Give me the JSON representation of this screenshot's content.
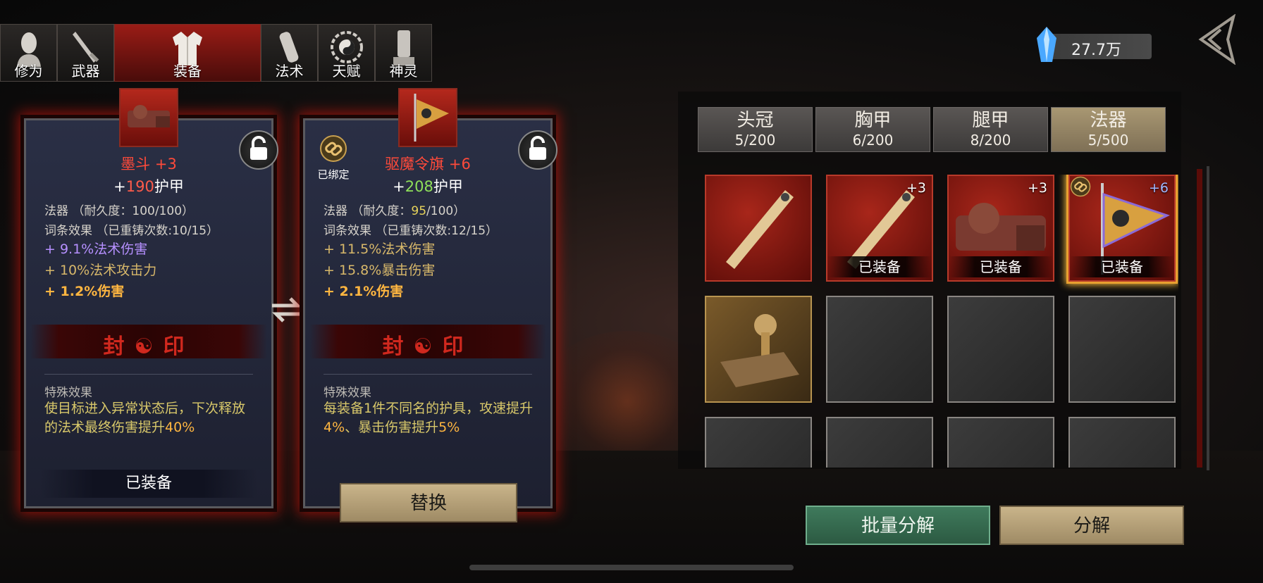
{
  "nav_tabs": [
    {
      "label": "修为",
      "icon": "cultivator-bust-icon",
      "active": false
    },
    {
      "label": "武器",
      "icon": "sword-icon",
      "active": false
    },
    {
      "label": "装备",
      "icon": "robe-icon",
      "active": true
    },
    {
      "label": "法术",
      "icon": "gourd-icon",
      "active": false
    },
    {
      "label": "天赋",
      "icon": "bagua-icon",
      "active": false
    },
    {
      "label": "神灵",
      "icon": "tablet-icon",
      "active": false
    }
  ],
  "currency": {
    "value": "27.7万",
    "icon": "spirit-crystal-icon"
  },
  "left_card": {
    "name": "墨斗 +3",
    "armor_prefix": "+",
    "armor_value": "190",
    "armor_suffix": "护甲",
    "type_label": "法器",
    "durability_label": "（耐久度：",
    "durability_current": "100",
    "durability_max": "/100）",
    "affix_label": "词条效果 （已重铸次数:10/15）",
    "affixes": [
      "+ 9.1%法术伤害",
      "+ 10%法术攻击力",
      "+ 1.2%伤害"
    ],
    "seal_text": "封☯印",
    "special_header": "特殊效果",
    "special_desc_a": "使目标进入异常状态后，下次释放的法术最终伤害提升",
    "special_desc_b": "40%",
    "status": "已装备"
  },
  "right_card": {
    "name": "驱魔令旗 +6",
    "bound_label": "已绑定",
    "armor_prefix": "+",
    "armor_value": "208",
    "armor_suffix": "护甲",
    "type_label": "法器",
    "durability_label": "（耐久度：",
    "durability_current": "95",
    "durability_max": "/100）",
    "affix_label": "词条效果 （已重铸次数:12/15）",
    "affixes": [
      "+ 11.5%法术伤害",
      "+ 15.8%暴击伤害",
      "+ 2.1%伤害"
    ],
    "seal_text": "封☯印",
    "special_header": "特殊效果",
    "special_desc_a": "每装备1件不同名的护具，攻速提升",
    "special_desc_b": "4%",
    "special_desc_c": "、暴击伤害提升",
    "special_desc_d": "5%"
  },
  "buttons": {
    "replace": "替换",
    "batch_decompose": "批量分解",
    "decompose": "分解"
  },
  "inventory_tabs": [
    {
      "label": "头冠",
      "count": "5/200",
      "active": false
    },
    {
      "label": "胸甲",
      "count": "6/200",
      "active": false
    },
    {
      "label": "腿甲",
      "count": "8/200",
      "active": false
    },
    {
      "label": "法器",
      "count": "5/500",
      "active": true
    }
  ],
  "inventory": [
    {
      "item": "ruler-talisman",
      "plus": "",
      "equipped": ""
    },
    {
      "item": "ruler-talisman",
      "plus": "+3",
      "equipped": "已装备"
    },
    {
      "item": "ink-box",
      "plus": "+3",
      "equipped": "已装备"
    },
    {
      "item": "exorcism-flag",
      "plus": "+6",
      "equipped": "已装备",
      "selected": true,
      "bound": true
    },
    {
      "item": "seal-stamp",
      "plus": "",
      "equipped": ""
    }
  ],
  "colors": {
    "accent_red": "#c8281c",
    "gold": "#d8b86a",
    "green_stat": "#8fe05a",
    "purple_affix": "#b690ff"
  }
}
